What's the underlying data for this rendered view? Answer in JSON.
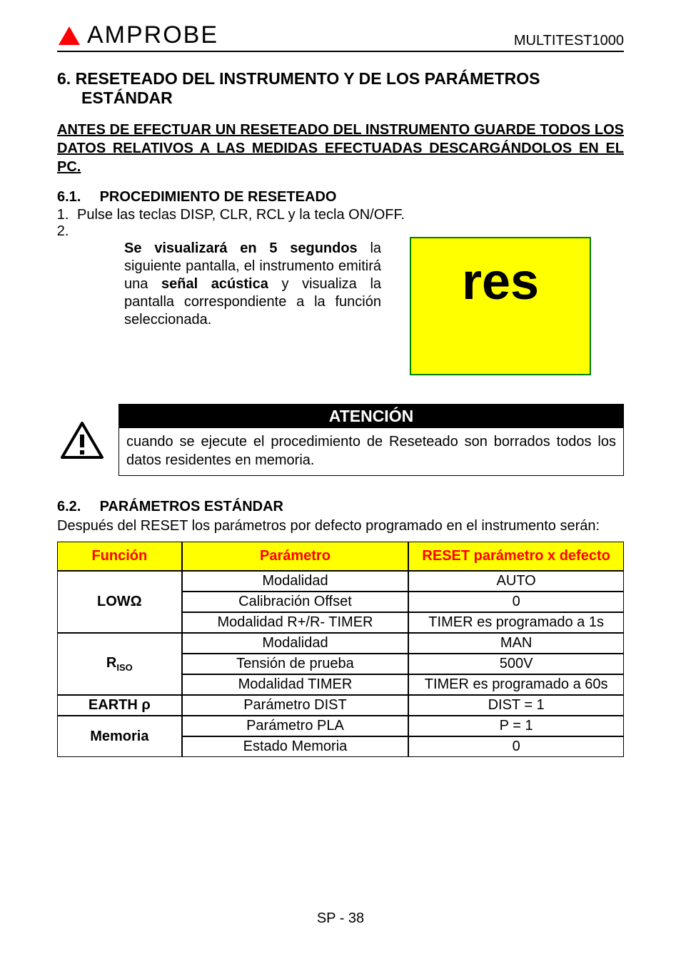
{
  "header": {
    "brand": "AMPROBE",
    "model": "MULTITEST1000"
  },
  "section": {
    "num": "6.",
    "title_line": "RESETEADO DEL INSTRUMENTO Y DE LOS PARÁMETROS",
    "title_indent": "ESTÁNDAR"
  },
  "warning_block": "ANTES DE EFECTUAR UN RESETEADO DEL INSTRUMENTO GUARDE TODOS LOS DATOS RELATIVOS A LAS MEDIDAS EFECTUADAS DESCARGÁNDOLOS EN EL PC.",
  "s61": {
    "num": "6.1.",
    "title": "PROCEDIMIENTO DE RESETEADO",
    "step1": "Pulse las teclas DISP, CLR, RCL y la tecla ON/OFF.",
    "step2": "",
    "desc_pre": "Se visualizará en 5 segundos",
    "desc_mid1": " la siguiente pantalla, el instrumento emitirá una ",
    "desc_bold2": "señal acústica",
    "desc_post": " y visualiza la pantalla correspondiente a la función seleccionada.",
    "screen": "res"
  },
  "atencion": {
    "title": "ATENCIÓN",
    "body": "cuando se ejecute el procedimiento de Reseteado son borrados todos los datos residentes en memoria."
  },
  "s62": {
    "num": "6.2.",
    "title": "PARÁMETROS ESTÁNDAR",
    "intro": "Después del RESET los parámetros por defecto programado en el instrumento serán:"
  },
  "table": {
    "h1": "Función",
    "h2": "Parámetro",
    "h3": "RESET parámetro x defecto",
    "rows": [
      {
        "func": "LOWΩ",
        "param": "Modalidad",
        "val": "AUTO"
      },
      {
        "func": "",
        "param": "Calibración Offset",
        "val": "0"
      },
      {
        "func": "",
        "param": "Modalidad R+/R- TIMER",
        "val": "TIMER es programado a 1s"
      },
      {
        "func": "RISO",
        "param": "Modalidad",
        "val": "MAN"
      },
      {
        "func": "",
        "param": "Tensión de prueba",
        "val": "500V"
      },
      {
        "func": "",
        "param": "Modalidad TIMER",
        "val": "TIMER es programado a 60s"
      },
      {
        "func": "EARTH ρ",
        "param": "Parámetro DIST",
        "val": "DIST = 1"
      },
      {
        "func": "Memoria",
        "param": "Parámetro PLA",
        "val": "P = 1"
      },
      {
        "func": "",
        "param": "Estado Memoria",
        "val": "0"
      }
    ]
  },
  "footer": "SP - 38"
}
